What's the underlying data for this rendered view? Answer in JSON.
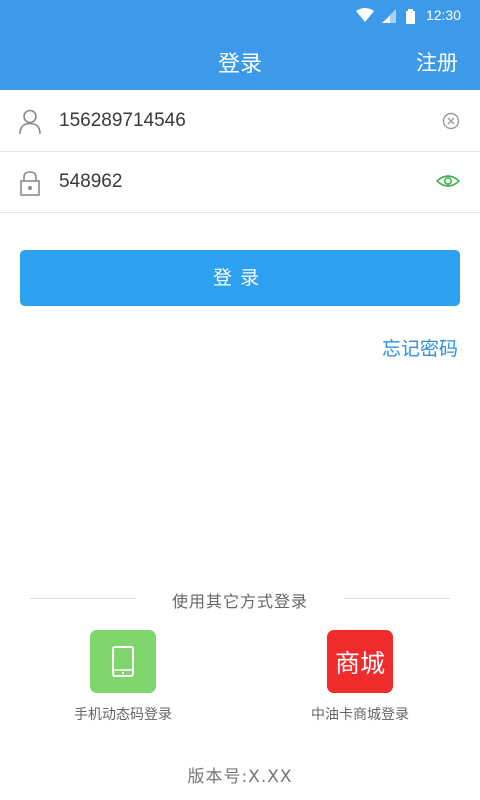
{
  "status_bar": {
    "time": "12:30",
    "icons": [
      "wifi-icon",
      "signal-icon",
      "battery-icon"
    ]
  },
  "header": {
    "title": "登录",
    "register_label": "注册",
    "background": "#3d9aea"
  },
  "form": {
    "username": {
      "value": "156289714546",
      "icon": "user-icon",
      "action_icon": "clear-icon"
    },
    "password": {
      "value": "548962",
      "icon": "lock-icon",
      "action_icon": "eye-icon"
    }
  },
  "login_button": {
    "label": "登录",
    "color": "#2ea0f0"
  },
  "forgot_password": "忘记密码",
  "other_methods": {
    "title": "使用其它方式登录",
    "options": [
      {
        "label": "手机动态码登录",
        "icon": "phone-icon",
        "color": "#7dd56b"
      },
      {
        "label": "中油卡商城登录",
        "icon_text": "商城",
        "color": "#ef2b2b"
      }
    ]
  },
  "version": "版本号:X.XX"
}
